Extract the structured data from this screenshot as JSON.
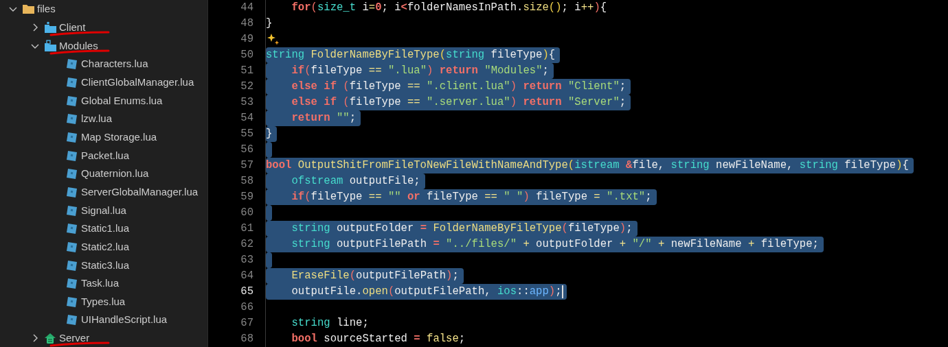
{
  "explorer": {
    "tree": [
      {
        "label": "files",
        "kind": "folder",
        "expanded": true,
        "children": [
          {
            "label": "Client",
            "kind": "client-folder",
            "expanded": false,
            "annotated": true
          },
          {
            "label": "Modules",
            "kind": "modules-folder",
            "expanded": true,
            "annotated": true,
            "children": [
              {
                "label": "Characters.lua",
                "kind": "lua-file"
              },
              {
                "label": "ClientGlobalManager.lua",
                "kind": "lua-file"
              },
              {
                "label": "Global Enums.lua",
                "kind": "lua-file"
              },
              {
                "label": "lzw.lua",
                "kind": "lua-file"
              },
              {
                "label": "Map Storage.lua",
                "kind": "lua-file"
              },
              {
                "label": "Packet.lua",
                "kind": "lua-file"
              },
              {
                "label": "Quaternion.lua",
                "kind": "lua-file"
              },
              {
                "label": "ServerGlobalManager.lua",
                "kind": "lua-file"
              },
              {
                "label": "Signal.lua",
                "kind": "lua-file"
              },
              {
                "label": "Static1.lua",
                "kind": "lua-file"
              },
              {
                "label": "Static2.lua",
                "kind": "lua-file"
              },
              {
                "label": "Static3.lua",
                "kind": "lua-file"
              },
              {
                "label": "Task.lua",
                "kind": "lua-file"
              },
              {
                "label": "Types.lua",
                "kind": "lua-file"
              },
              {
                "label": "UIHandleScript.lua",
                "kind": "lua-file"
              }
            ]
          },
          {
            "label": "Server",
            "kind": "server-folder",
            "expanded": false,
            "annotated": true
          }
        ]
      }
    ]
  },
  "editor": {
    "lines": [
      {
        "number": "44",
        "selected": false,
        "current": false,
        "indented": true,
        "tokens": [
          {
            "text": "for",
            "kind": "keyword"
          },
          {
            "text": "(",
            "kind": "bracket-red"
          },
          {
            "text": "size_t",
            "kind": "type"
          },
          {
            "text": " i",
            "kind": "plain"
          },
          {
            "text": "=",
            "kind": "operator"
          },
          {
            "text": "0",
            "kind": "keyword"
          },
          {
            "text": "; i",
            "kind": "plain"
          },
          {
            "text": "<",
            "kind": "keyword"
          },
          {
            "text": "folderNamesInPath.",
            "kind": "plain"
          },
          {
            "text": "size",
            "kind": "function"
          },
          {
            "text": "()",
            "kind": "bracket-yellow"
          },
          {
            "text": "; i",
            "kind": "plain"
          },
          {
            "text": "++",
            "kind": "operator"
          },
          {
            "text": ")",
            "kind": "bracket-red"
          },
          {
            "text": "{",
            "kind": "plain"
          }
        ]
      },
      {
        "number": "48",
        "selected": false,
        "current": false,
        "indented": false,
        "tokens": [
          {
            "text": "}",
            "kind": "plain"
          }
        ]
      },
      {
        "number": "49",
        "selected": false,
        "current": false,
        "suggestion": true
      },
      {
        "number": "50",
        "selected": true,
        "current": false,
        "indented": false,
        "tokens": [
          {
            "text": "string",
            "kind": "type"
          },
          {
            "text": " FolderNameByFileType",
            "kind": "function"
          },
          {
            "text": "(",
            "kind": "bracket-yellow"
          },
          {
            "text": "string",
            "kind": "type"
          },
          {
            "text": " fileType",
            "kind": "plain"
          },
          {
            "text": ")",
            "kind": "bracket-yellow"
          },
          {
            "text": "{",
            "kind": "plain"
          }
        ]
      },
      {
        "number": "51",
        "selected": true,
        "current": false,
        "indented": true,
        "tokens": [
          {
            "text": "if",
            "kind": "keyword"
          },
          {
            "text": "(",
            "kind": "bracket-red"
          },
          {
            "text": "fileType ",
            "kind": "plain"
          },
          {
            "text": "==",
            "kind": "operator"
          },
          {
            "text": " \".lua\"",
            "kind": "string"
          },
          {
            "text": ")",
            "kind": "bracket-red"
          },
          {
            "text": " return",
            "kind": "keyword"
          },
          {
            "text": " \"Modules\"",
            "kind": "string"
          },
          {
            "text": ";",
            "kind": "plain"
          }
        ]
      },
      {
        "number": "52",
        "selected": true,
        "current": false,
        "indented": true,
        "tokens": [
          {
            "text": "else if",
            "kind": "keyword"
          },
          {
            "text": " (",
            "kind": "bracket-red"
          },
          {
            "text": "fileType ",
            "kind": "plain"
          },
          {
            "text": "==",
            "kind": "operator"
          },
          {
            "text": " \".client.lua\"",
            "kind": "string"
          },
          {
            "text": ")",
            "kind": "bracket-red"
          },
          {
            "text": " return",
            "kind": "keyword"
          },
          {
            "text": " \"Client\"",
            "kind": "string"
          },
          {
            "text": ";",
            "kind": "plain"
          }
        ]
      },
      {
        "number": "53",
        "selected": true,
        "current": false,
        "indented": true,
        "tokens": [
          {
            "text": "else if",
            "kind": "keyword"
          },
          {
            "text": " (",
            "kind": "bracket-red"
          },
          {
            "text": "fileType ",
            "kind": "plain"
          },
          {
            "text": "==",
            "kind": "operator"
          },
          {
            "text": " \".server.lua\"",
            "kind": "string"
          },
          {
            "text": ")",
            "kind": "bracket-red"
          },
          {
            "text": " return",
            "kind": "keyword"
          },
          {
            "text": " \"Server\"",
            "kind": "string"
          },
          {
            "text": ";",
            "kind": "plain"
          }
        ]
      },
      {
        "number": "54",
        "selected": true,
        "current": false,
        "indented": true,
        "tokens": [
          {
            "text": "return",
            "kind": "keyword"
          },
          {
            "text": " \"\"",
            "kind": "string"
          },
          {
            "text": ";",
            "kind": "plain"
          }
        ]
      },
      {
        "number": "55",
        "selected": true,
        "current": false,
        "indented": false,
        "tokens": [
          {
            "text": "}",
            "kind": "plain"
          }
        ]
      },
      {
        "number": "56",
        "selected": true,
        "current": false
      },
      {
        "number": "57",
        "selected": true,
        "current": false,
        "indented": false,
        "tokens": [
          {
            "text": "bool",
            "kind": "keyword"
          },
          {
            "text": " OutputShitFromFileToNewFileWithNameAndType",
            "kind": "function"
          },
          {
            "text": "(",
            "kind": "bracket-yellow"
          },
          {
            "text": "istream",
            "kind": "type"
          },
          {
            "text": " &",
            "kind": "keyword"
          },
          {
            "text": "file, ",
            "kind": "plain"
          },
          {
            "text": "string",
            "kind": "type"
          },
          {
            "text": " newFileName, ",
            "kind": "plain"
          },
          {
            "text": "string",
            "kind": "type"
          },
          {
            "text": " fileType",
            "kind": "plain"
          },
          {
            "text": ")",
            "kind": "bracket-yellow"
          },
          {
            "text": "{",
            "kind": "plain"
          }
        ]
      },
      {
        "number": "58",
        "selected": true,
        "current": false,
        "indented": true,
        "tokens": [
          {
            "text": "ofstream",
            "kind": "type"
          },
          {
            "text": " outputFile;",
            "kind": "plain"
          }
        ]
      },
      {
        "number": "59",
        "selected": true,
        "current": false,
        "indented": true,
        "tokens": [
          {
            "text": "if",
            "kind": "keyword"
          },
          {
            "text": "(",
            "kind": "bracket-red"
          },
          {
            "text": "fileType ",
            "kind": "plain"
          },
          {
            "text": "==",
            "kind": "operator"
          },
          {
            "text": " \"\"",
            "kind": "string"
          },
          {
            "text": " or",
            "kind": "keyword"
          },
          {
            "text": " fileType ",
            "kind": "plain"
          },
          {
            "text": "==",
            "kind": "operator"
          },
          {
            "text": " \" \"",
            "kind": "string"
          },
          {
            "text": ")",
            "kind": "bracket-red"
          },
          {
            "text": " fileType ",
            "kind": "plain"
          },
          {
            "text": "=",
            "kind": "operator"
          },
          {
            "text": " \".txt\"",
            "kind": "string"
          },
          {
            "text": ";",
            "kind": "plain"
          }
        ]
      },
      {
        "number": "60",
        "selected": true,
        "current": false
      },
      {
        "number": "61",
        "selected": true,
        "current": false,
        "indented": true,
        "tokens": [
          {
            "text": "string",
            "kind": "type"
          },
          {
            "text": " outputFolder ",
            "kind": "plain"
          },
          {
            "text": "=",
            "kind": "keyword"
          },
          {
            "text": " FolderNameByFileType",
            "kind": "function"
          },
          {
            "text": "(",
            "kind": "bracket-red"
          },
          {
            "text": "fileType",
            "kind": "plain"
          },
          {
            "text": ")",
            "kind": "bracket-red"
          },
          {
            "text": ";",
            "kind": "plain"
          }
        ]
      },
      {
        "number": "62",
        "selected": true,
        "current": false,
        "indented": true,
        "tokens": [
          {
            "text": "string",
            "kind": "type"
          },
          {
            "text": " outputFilePath ",
            "kind": "plain"
          },
          {
            "text": "=",
            "kind": "keyword"
          },
          {
            "text": " \"../files/\"",
            "kind": "string"
          },
          {
            "text": " +",
            "kind": "operator"
          },
          {
            "text": " outputFolder ",
            "kind": "plain"
          },
          {
            "text": "+",
            "kind": "operator"
          },
          {
            "text": " \"/\"",
            "kind": "string"
          },
          {
            "text": " +",
            "kind": "operator"
          },
          {
            "text": " newFileName ",
            "kind": "plain"
          },
          {
            "text": "+",
            "kind": "operator"
          },
          {
            "text": " fileType;",
            "kind": "plain"
          }
        ]
      },
      {
        "number": "63",
        "selected": true,
        "current": false
      },
      {
        "number": "64",
        "selected": true,
        "current": false,
        "indented": true,
        "tokens": [
          {
            "text": "EraseFile",
            "kind": "function"
          },
          {
            "text": "(",
            "kind": "bracket-red"
          },
          {
            "text": "outputFilePath",
            "kind": "plain"
          },
          {
            "text": ")",
            "kind": "bracket-red"
          },
          {
            "text": ";",
            "kind": "plain"
          }
        ]
      },
      {
        "number": "65",
        "selected": true,
        "current": true,
        "indented": true,
        "tokens": [
          {
            "text": "outputFile.",
            "kind": "plain"
          },
          {
            "text": "open",
            "kind": "function"
          },
          {
            "text": "(",
            "kind": "bracket-red"
          },
          {
            "text": "outputFilePath, ",
            "kind": "plain"
          },
          {
            "text": "ios",
            "kind": "type"
          },
          {
            "text": "::",
            "kind": "plain"
          },
          {
            "text": "app",
            "kind": "member"
          },
          {
            "text": ")",
            "kind": "bracket-red"
          },
          {
            "text": ";",
            "kind": "plain"
          }
        ]
      },
      {
        "number": "66",
        "selected": false,
        "current": false
      },
      {
        "number": "67",
        "selected": false,
        "current": false,
        "indented": true,
        "tokens": [
          {
            "text": "string",
            "kind": "type"
          },
          {
            "text": " line;",
            "kind": "plain"
          }
        ]
      },
      {
        "number": "68",
        "selected": false,
        "current": false,
        "indented": true,
        "tokens": [
          {
            "text": "bool",
            "kind": "keyword"
          },
          {
            "text": " sourceStarted ",
            "kind": "plain"
          },
          {
            "text": "=",
            "kind": "keyword"
          },
          {
            "text": " false",
            "kind": "operator"
          },
          {
            "text": ";",
            "kind": "plain"
          }
        ]
      }
    ]
  }
}
